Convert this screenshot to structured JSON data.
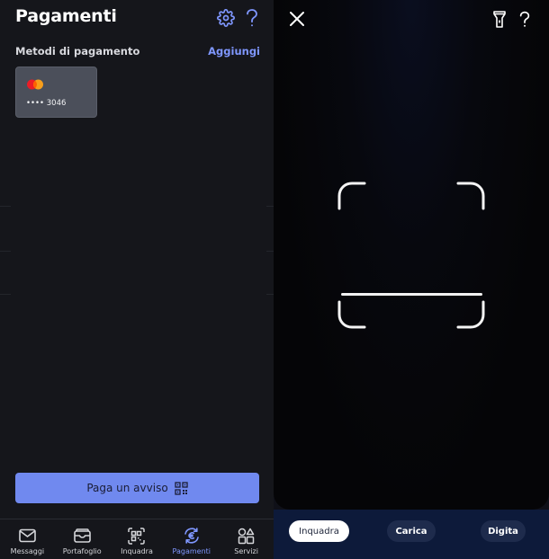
{
  "left": {
    "title": "Pagamenti",
    "icons": {
      "settings": "gear-icon",
      "help": "question-icon"
    },
    "section": {
      "title": "Metodi di pagamento",
      "action": "Aggiungi"
    },
    "card": {
      "brand_icon": "mastercard-logo",
      "number": "•••• 3046"
    },
    "primary_button": {
      "label": "Paga un avviso",
      "icon": "qr-code-icon"
    },
    "nav": [
      {
        "label": "Messaggi",
        "icon": "envelope-icon"
      },
      {
        "label": "Portafoglio",
        "icon": "wallet-icon"
      },
      {
        "label": "Inquadra",
        "icon": "qr-scan-icon"
      },
      {
        "label": "Pagamenti",
        "icon": "euro-exchange-icon",
        "active": true
      },
      {
        "label": "Servizi",
        "icon": "grid-icon"
      }
    ]
  },
  "right": {
    "icons": {
      "close": "close-icon",
      "torch": "flashlight-icon",
      "help": "question-icon"
    },
    "modes": [
      {
        "label": "Inquadra",
        "selected": true
      },
      {
        "label": "Carica",
        "selected": false
      },
      {
        "label": "Digita",
        "selected": false
      }
    ]
  },
  "colors": {
    "accent": "#7f97ff",
    "button": "#7089ef",
    "panel_bg": "#15161b",
    "mode_bar_bg": "#0d1a3a"
  }
}
